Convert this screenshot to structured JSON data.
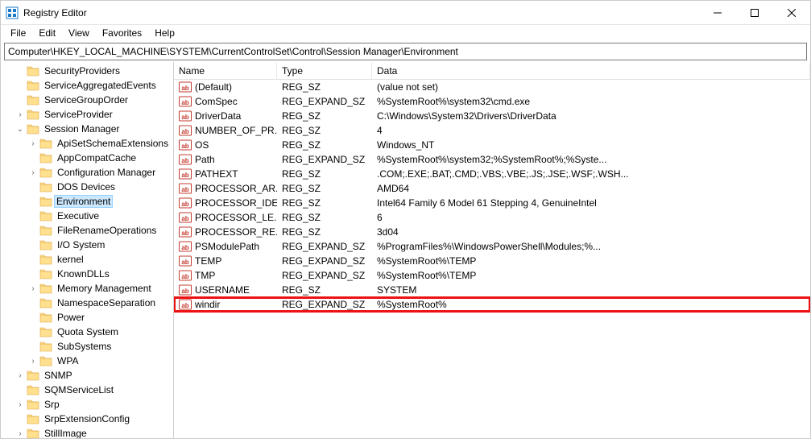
{
  "title": "Registry Editor",
  "menu": {
    "file": "File",
    "edit": "Edit",
    "view": "View",
    "favorites": "Favorites",
    "help": "Help"
  },
  "address": "Computer\\HKEY_LOCAL_MACHINE\\SYSTEM\\CurrentControlSet\\Control\\Session Manager\\Environment",
  "tree": [
    {
      "label": "SecurityProviders",
      "indent": 1,
      "expander": ""
    },
    {
      "label": "ServiceAggregatedEvents",
      "indent": 1,
      "expander": ""
    },
    {
      "label": "ServiceGroupOrder",
      "indent": 1,
      "expander": ""
    },
    {
      "label": "ServiceProvider",
      "indent": 1,
      "expander": ">"
    },
    {
      "label": "Session Manager",
      "indent": 1,
      "expander": "v"
    },
    {
      "label": "ApiSetSchemaExtensions",
      "indent": 2,
      "expander": ">"
    },
    {
      "label": "AppCompatCache",
      "indent": 2,
      "expander": ""
    },
    {
      "label": "Configuration Manager",
      "indent": 2,
      "expander": ">"
    },
    {
      "label": "DOS Devices",
      "indent": 2,
      "expander": ""
    },
    {
      "label": "Environment",
      "indent": 2,
      "expander": "",
      "selected": true
    },
    {
      "label": "Executive",
      "indent": 2,
      "expander": ""
    },
    {
      "label": "FileRenameOperations",
      "indent": 2,
      "expander": ""
    },
    {
      "label": "I/O System",
      "indent": 2,
      "expander": ""
    },
    {
      "label": "kernel",
      "indent": 2,
      "expander": ""
    },
    {
      "label": "KnownDLLs",
      "indent": 2,
      "expander": ""
    },
    {
      "label": "Memory Management",
      "indent": 2,
      "expander": ">"
    },
    {
      "label": "NamespaceSeparation",
      "indent": 2,
      "expander": ""
    },
    {
      "label": "Power",
      "indent": 2,
      "expander": ""
    },
    {
      "label": "Quota System",
      "indent": 2,
      "expander": ""
    },
    {
      "label": "SubSystems",
      "indent": 2,
      "expander": ""
    },
    {
      "label": "WPA",
      "indent": 2,
      "expander": ">"
    },
    {
      "label": "SNMP",
      "indent": 1,
      "expander": ">"
    },
    {
      "label": "SQMServiceList",
      "indent": 1,
      "expander": ""
    },
    {
      "label": "Srp",
      "indent": 1,
      "expander": ">"
    },
    {
      "label": "SrpExtensionConfig",
      "indent": 1,
      "expander": ""
    },
    {
      "label": "StillImage",
      "indent": 1,
      "expander": ">"
    }
  ],
  "columns": {
    "name": "Name",
    "type": "Type",
    "data": "Data"
  },
  "values": [
    {
      "name": "(Default)",
      "type": "REG_SZ",
      "data": "(value not set)"
    },
    {
      "name": "ComSpec",
      "type": "REG_EXPAND_SZ",
      "data": "%SystemRoot%\\system32\\cmd.exe"
    },
    {
      "name": "DriverData",
      "type": "REG_SZ",
      "data": "C:\\Windows\\System32\\Drivers\\DriverData"
    },
    {
      "name": "NUMBER_OF_PR...",
      "type": "REG_SZ",
      "data": "4"
    },
    {
      "name": "OS",
      "type": "REG_SZ",
      "data": "Windows_NT"
    },
    {
      "name": "Path",
      "type": "REG_EXPAND_SZ",
      "data": "%SystemRoot%\\system32;%SystemRoot%;%Syste..."
    },
    {
      "name": "PATHEXT",
      "type": "REG_SZ",
      "data": ".COM;.EXE;.BAT;.CMD;.VBS;.VBE;.JS;.JSE;.WSF;.WSH..."
    },
    {
      "name": "PROCESSOR_AR...",
      "type": "REG_SZ",
      "data": "AMD64"
    },
    {
      "name": "PROCESSOR_IDE...",
      "type": "REG_SZ",
      "data": "Intel64 Family 6 Model 61 Stepping 4, GenuineIntel"
    },
    {
      "name": "PROCESSOR_LE...",
      "type": "REG_SZ",
      "data": "6"
    },
    {
      "name": "PROCESSOR_RE...",
      "type": "REG_SZ",
      "data": "3d04"
    },
    {
      "name": "PSModulePath",
      "type": "REG_EXPAND_SZ",
      "data": "%ProgramFiles%\\WindowsPowerShell\\Modules;%..."
    },
    {
      "name": "TEMP",
      "type": "REG_EXPAND_SZ",
      "data": "%SystemRoot%\\TEMP"
    },
    {
      "name": "TMP",
      "type": "REG_EXPAND_SZ",
      "data": "%SystemRoot%\\TEMP"
    },
    {
      "name": "USERNAME",
      "type": "REG_SZ",
      "data": "SYSTEM"
    },
    {
      "name": "windir",
      "type": "REG_EXPAND_SZ",
      "data": "%SystemRoot%",
      "highlighted": true
    }
  ]
}
